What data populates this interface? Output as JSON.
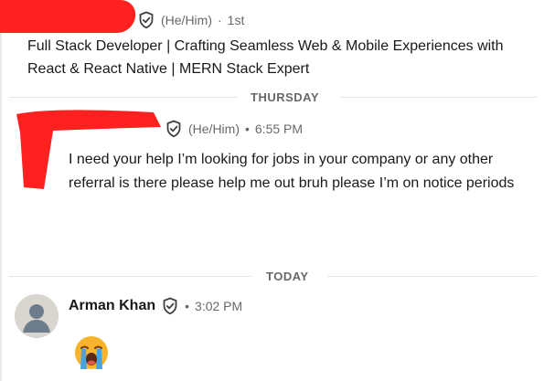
{
  "top_profile": {
    "pronouns": "(He/Him)",
    "separator": "·",
    "connection_degree": "1st",
    "headline": "Full Stack Developer | Crafting Seamless Web & Mobile Experiences with React & React Native | MERN Stack Expert"
  },
  "thursday_group": {
    "day_label": "THURSDAY",
    "pronouns": "(He/Him)",
    "bullet": "•",
    "time": "6:55 PM",
    "message": "I need your help I’m looking for jobs in your company or any other referral is there please help me out bruh please I’m on notice periods"
  },
  "today_group": {
    "day_label": "TODAY",
    "sender_name": "Arman Khan",
    "bullet": "•",
    "time": "3:02 PM",
    "reaction_emoji": "loudly-crying-face"
  },
  "colors": {
    "redaction": "#ff2020",
    "verified": "#404040"
  }
}
